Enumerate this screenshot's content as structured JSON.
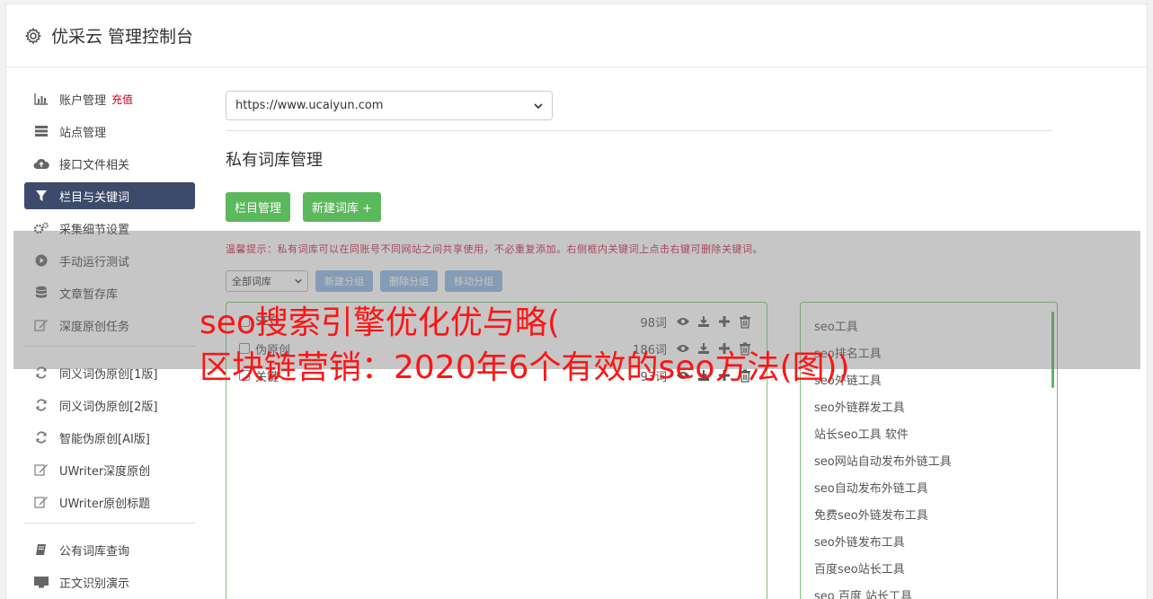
{
  "header": {
    "title": "优采云 管理控制台",
    "icon": "gear-icon"
  },
  "sidebar": {
    "items": [
      {
        "label": "账户管理",
        "badge": "充值",
        "icon": "bar-chart-icon"
      },
      {
        "label": "站点管理",
        "icon": "server-icon"
      },
      {
        "label": "接口文件相关",
        "icon": "cloud-upload-icon"
      },
      {
        "label": "栏目与关键词",
        "icon": "filter-icon",
        "active": true
      },
      {
        "label": "采集细节设置",
        "icon": "cogs-icon"
      },
      {
        "label": "手动运行测试",
        "icon": "play-circle-icon"
      },
      {
        "label": "文章暂存库",
        "icon": "database-icon"
      },
      {
        "label": "深度原创任务",
        "icon": "edit-icon"
      }
    ],
    "items2": [
      {
        "label": "同义词伪原创[1版]",
        "icon": "refresh-icon"
      },
      {
        "label": "同义词伪原创[2版]",
        "icon": "refresh-icon"
      },
      {
        "label": "智能伪原创[AI版]",
        "icon": "refresh-icon"
      },
      {
        "label": "UWriter深度原创",
        "icon": "edit-icon"
      },
      {
        "label": "UWriter原创标题",
        "icon": "edit-icon"
      }
    ],
    "items3": [
      {
        "label": "公有词库查询",
        "icon": "book-icon"
      },
      {
        "label": "正文识别演示",
        "icon": "monitor-icon"
      }
    ]
  },
  "main": {
    "site_select": "https://www.ucaiyun.com",
    "section_title": "私有词库管理",
    "btn_category": "栏目管理",
    "btn_new_lib": "新建词库 +",
    "tip": "温馨提示：私有词库可以在同账号不同网站之间共享使用，不必重复添加。右侧框内关键词上点击右键可删除关键词。",
    "lib_filter": "全部词库",
    "btn_new_group": "新建分组",
    "btn_delete_group": "删除分组",
    "btn_move_group": "移动分组",
    "libraries": [
      {
        "name": "SEO",
        "count": "98词"
      },
      {
        "name": "伪原创",
        "count": "186词"
      },
      {
        "name": "关键",
        "count": "93词"
      }
    ],
    "keywords": [
      "seo工具",
      "seo排名工具",
      "seo外链工具",
      "seo外链群发工具",
      "站长seo工具 软件",
      "seo网站自动发布外链工具",
      "seo自动发布外链工具",
      "免费seo外链发布工具",
      "seo外链发布工具",
      "百度seo站长工具",
      "seo 百度 站长工具"
    ]
  },
  "overlay": {
    "line1": "seo搜索引擎优化优与略(",
    "line2": "区块链营销：2020年6个有效的seo方法(图))"
  },
  "colors": {
    "active_bg": "#3c4a6b",
    "green": "#5cb85c",
    "blue": "#8fb7e3",
    "overlay_text": "#ff1414",
    "tip": "#c7254e"
  }
}
